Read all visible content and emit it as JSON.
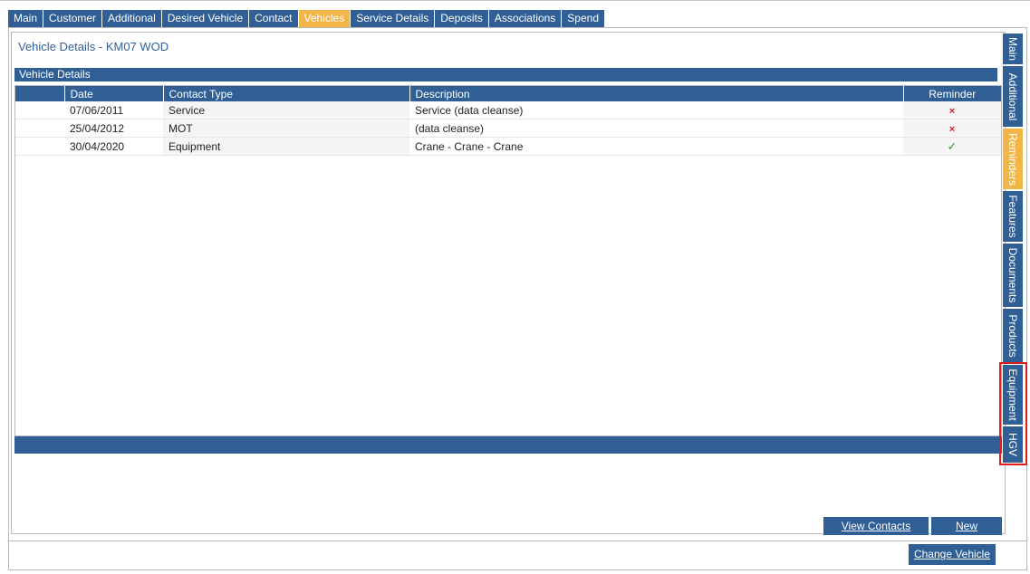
{
  "tabs": [
    {
      "label": "Main"
    },
    {
      "label": "Customer"
    },
    {
      "label": "Additional"
    },
    {
      "label": "Desired Vehicle"
    },
    {
      "label": "Contact"
    },
    {
      "label": "Vehicles",
      "active": true
    },
    {
      "label": "Service Details"
    },
    {
      "label": "Deposits"
    },
    {
      "label": "Associations"
    },
    {
      "label": "Spend"
    }
  ],
  "vehicle": {
    "title": "Vehicle Details - KM07 WOD",
    "section_label": "Vehicle Details"
  },
  "table": {
    "headers": [
      "",
      "Date",
      "Contact Type",
      "Description",
      "Reminder"
    ],
    "rows": [
      {
        "date": "07/06/2011",
        "contact_type": "Service",
        "description": "Service (data cleanse)",
        "reminder": "×"
      },
      {
        "date": "25/04/2012",
        "contact_type": "MOT",
        "description": "(data cleanse)",
        "reminder": "×"
      },
      {
        "date": "30/04/2020",
        "contact_type": "Equipment",
        "description": "Crane - Crane - Crane",
        "reminder": "✓"
      }
    ]
  },
  "side_tabs": [
    {
      "label": "Main"
    },
    {
      "label": "Additional"
    },
    {
      "label": "Reminders",
      "active": true
    },
    {
      "label": "Features"
    },
    {
      "label": "Documents"
    },
    {
      "label": "Products"
    },
    {
      "label": "Equipment"
    },
    {
      "label": "HGV"
    }
  ],
  "buttons": {
    "view_contacts": "View Contacts",
    "new": "New",
    "change_vehicle": "Change Vehicle"
  },
  "colors": {
    "primary": "#2f5f95",
    "active_tab": "#f2b547",
    "highlight": "#e21b1b",
    "cross": "#d62020",
    "tick": "#2e9a2e"
  }
}
